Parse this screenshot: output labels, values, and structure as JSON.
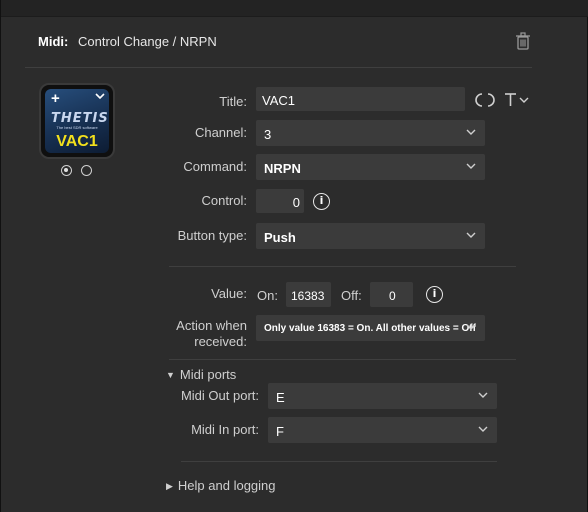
{
  "header": {
    "midi_label": "Midi:",
    "title": "Control Change / NRPN"
  },
  "thumbnail": {
    "plus": "+",
    "logo": "THETIS",
    "logo_sub": "The best SDR software",
    "label": "VAC1"
  },
  "form": {
    "title_label": "Title:",
    "title_value": "VAC1",
    "channel_label": "Channel:",
    "channel_value": "3",
    "command_label": "Command:",
    "command_value": "NRPN",
    "control_label": "Control:",
    "control_value": "0",
    "button_type_label": "Button type:",
    "button_type_value": "Push",
    "value_label": "Value:",
    "on_label": "On:",
    "on_value": "16383",
    "off_label": "Off:",
    "off_value": "0",
    "action_label_line1": "Action when",
    "action_label_line2": "received:",
    "action_value": "Only value 16383 = On. All other values = Off"
  },
  "midi_ports": {
    "section_label": "Midi ports",
    "out_label": "Midi Out port:",
    "out_value": "E",
    "in_label": "Midi In port:",
    "in_value": "F"
  },
  "help": {
    "section_label": "Help and logging"
  },
  "icons": {
    "trash": "trash-icon",
    "refresh": "refresh-icon",
    "text": "text-format-icon",
    "info": "info-icon",
    "chevron": "chevron-down-icon"
  },
  "colors": {
    "background": "#2c2c2c",
    "field": "#3b3b3b",
    "thumb_label": "#f2e01c"
  }
}
